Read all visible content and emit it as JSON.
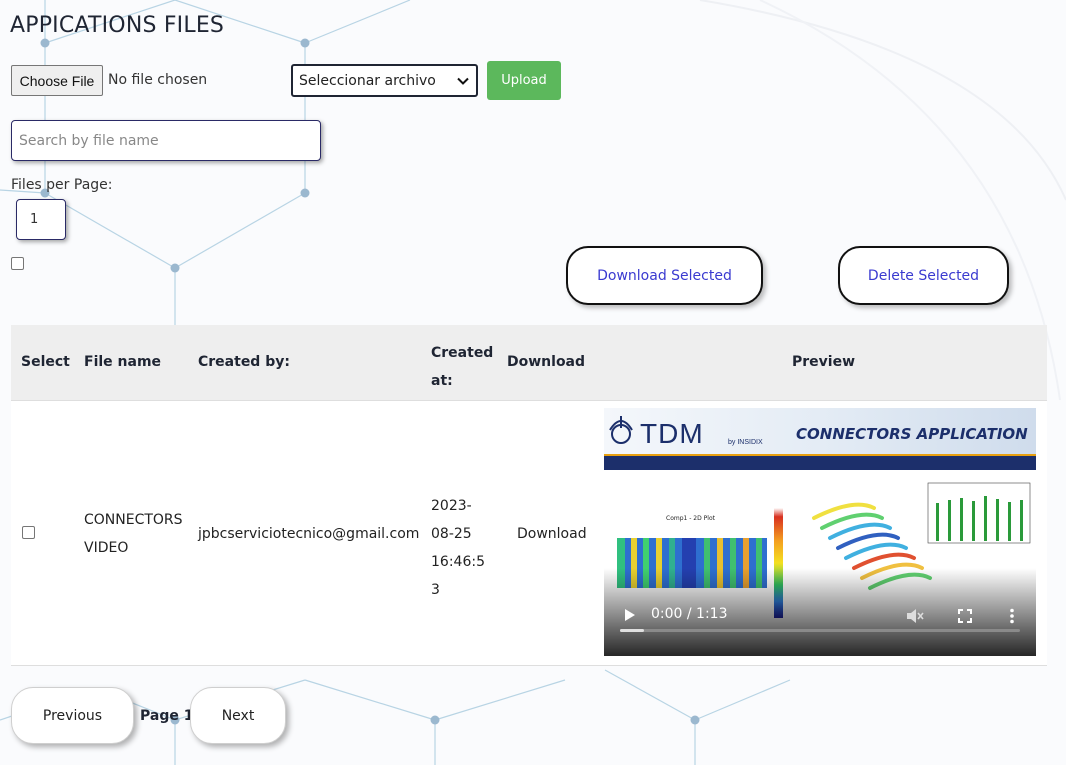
{
  "page": {
    "title": "APPICATIONS FILES"
  },
  "upload": {
    "choose_label": "Choose File",
    "file_status": "No file chosen",
    "select_value": "Seleccionar archivo",
    "upload_label": "Upload"
  },
  "search": {
    "placeholder": "Search by file name"
  },
  "pagination_settings": {
    "label": "Files per Page:",
    "value": "1"
  },
  "actions": {
    "download_selected": "Download Selected",
    "delete_selected": "Delete Selected"
  },
  "table": {
    "headers": {
      "select": "Select",
      "file_name": "File name",
      "created_by": "Created by:",
      "created_at": "Created at:",
      "download": "Download",
      "preview": "Preview"
    },
    "rows": [
      {
        "file_name": "CONNECTORS VIDEO",
        "created_by": "jpbcserviciotecnico@gmail.com",
        "created_at": "2023-08-25 16:46:53",
        "download": "Download",
        "preview": {
          "brand": "TDM",
          "brand_sub": "by INSIDIX",
          "banner": "CONNECTORS APPLICATION",
          "plot_title": "Comp1 - 2D Plot",
          "time": "0:00 / 1:13",
          "progress": 0.06
        }
      }
    ]
  },
  "pager": {
    "previous": "Previous",
    "page_label": "Page 1",
    "next": "Next"
  },
  "colors": {
    "upload": "#5cb85c",
    "link": "#3a3ad0",
    "header_bg": "#eeeeee"
  }
}
